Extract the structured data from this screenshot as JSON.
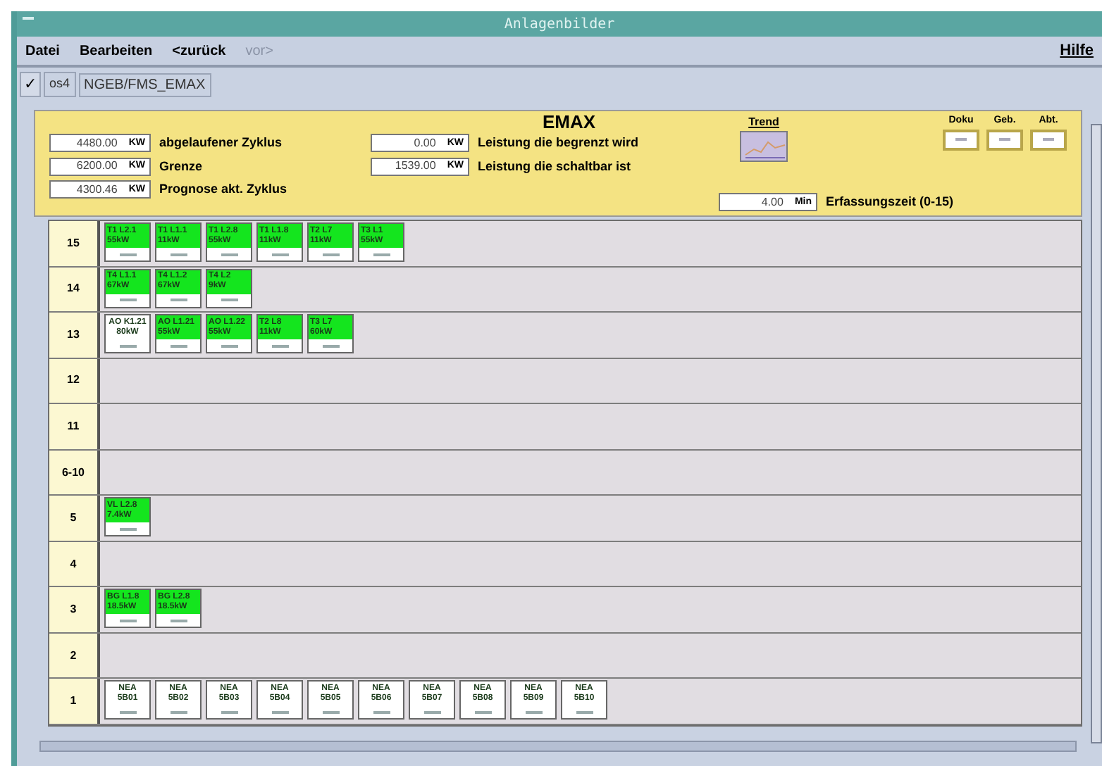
{
  "window": {
    "title": "Anlagenbilder"
  },
  "menu": [
    {
      "label": "Datei",
      "disabled": false
    },
    {
      "label": "Bearbeiten",
      "disabled": false
    },
    {
      "label": "<zurück",
      "disabled": false
    },
    {
      "label": "vor>",
      "disabled": true
    }
  ],
  "help": "Hilfe",
  "toolbar": {
    "check": "✓",
    "code": "os4",
    "path": "NGEB/FMS_EMAX"
  },
  "panel": {
    "title": "EMAX",
    "left_fields": [
      {
        "value": "4480.00",
        "unit": "KW",
        "label": "abgelaufener Zyklus"
      },
      {
        "value": "6200.00",
        "unit": "KW",
        "label": "Grenze"
      },
      {
        "value": "4300.46",
        "unit": "KW",
        "label": "Prognose akt. Zyklus"
      }
    ],
    "right_fields": [
      {
        "value": "0.00",
        "unit": "KW",
        "label": "Leistung die begrenzt wird"
      },
      {
        "value": "1539.00",
        "unit": "KW",
        "label": "Leistung die schaltbar ist"
      }
    ],
    "trend": "Trend",
    "buttons": [
      "Doku",
      "Geb.",
      "Abt."
    ],
    "time_field": {
      "value": "4.00",
      "unit": "Min",
      "label": "Erfassungszeit (0-15)"
    }
  },
  "rows": [
    {
      "label": "15",
      "tiles": [
        {
          "name": "T1 L2.1",
          "power": "55kW",
          "active": true
        },
        {
          "name": "T1 L1.1",
          "power": "11kW",
          "active": true
        },
        {
          "name": "T1 L2.8",
          "power": "55kW",
          "active": true
        },
        {
          "name": "T1 L1.8",
          "power": "11kW",
          "active": true
        },
        {
          "name": "T2 L7",
          "power": "11kW",
          "active": true
        },
        {
          "name": "T3 L1",
          "power": "55kW",
          "active": true
        }
      ]
    },
    {
      "label": "14",
      "tiles": [
        {
          "name": "T4 L1.1",
          "power": "67kW",
          "active": true
        },
        {
          "name": "T4 L1.2",
          "power": "67kW",
          "active": true
        },
        {
          "name": "T4 L2",
          "power": "9kW",
          "active": true
        }
      ]
    },
    {
      "label": "13",
      "tiles": [
        {
          "name": "AO K1.21",
          "power": "80kW",
          "active": false
        },
        {
          "name": "AO L1.21",
          "power": "55kW",
          "active": true
        },
        {
          "name": "AO L1.22",
          "power": "55kW",
          "active": true
        },
        {
          "name": "T2 L8",
          "power": "11kW",
          "active": true
        },
        {
          "name": "T3 L7",
          "power": "60kW",
          "active": true
        }
      ]
    },
    {
      "label": "12",
      "tiles": []
    },
    {
      "label": "11",
      "tiles": []
    },
    {
      "label": "6-10",
      "tiles": []
    },
    {
      "label": "5",
      "tiles": [
        {
          "name": "VL L2.8",
          "power": "7.4kW",
          "active": true
        }
      ]
    },
    {
      "label": "4",
      "tiles": []
    },
    {
      "label": "3",
      "tiles": [
        {
          "name": "BG L1.8",
          "power": "18.5kW",
          "active": true
        },
        {
          "name": "BG L2.8",
          "power": "18.5kW",
          "active": true
        }
      ]
    },
    {
      "label": "2",
      "tiles": []
    },
    {
      "label": "1",
      "tiles": [
        {
          "name": "NEA",
          "power": "5B01",
          "active": false
        },
        {
          "name": "NEA",
          "power": "5B02",
          "active": false
        },
        {
          "name": "NEA",
          "power": "5B03",
          "active": false
        },
        {
          "name": "NEA",
          "power": "5B04",
          "active": false
        },
        {
          "name": "NEA",
          "power": "5B05",
          "active": false
        },
        {
          "name": "NEA",
          "power": "5B06",
          "active": false
        },
        {
          "name": "NEA",
          "power": "5B07",
          "active": false
        },
        {
          "name": "NEA",
          "power": "5B08",
          "active": false
        },
        {
          "name": "NEA",
          "power": "5B09",
          "active": false
        },
        {
          "name": "NEA",
          "power": "5B10",
          "active": false
        }
      ]
    }
  ]
}
